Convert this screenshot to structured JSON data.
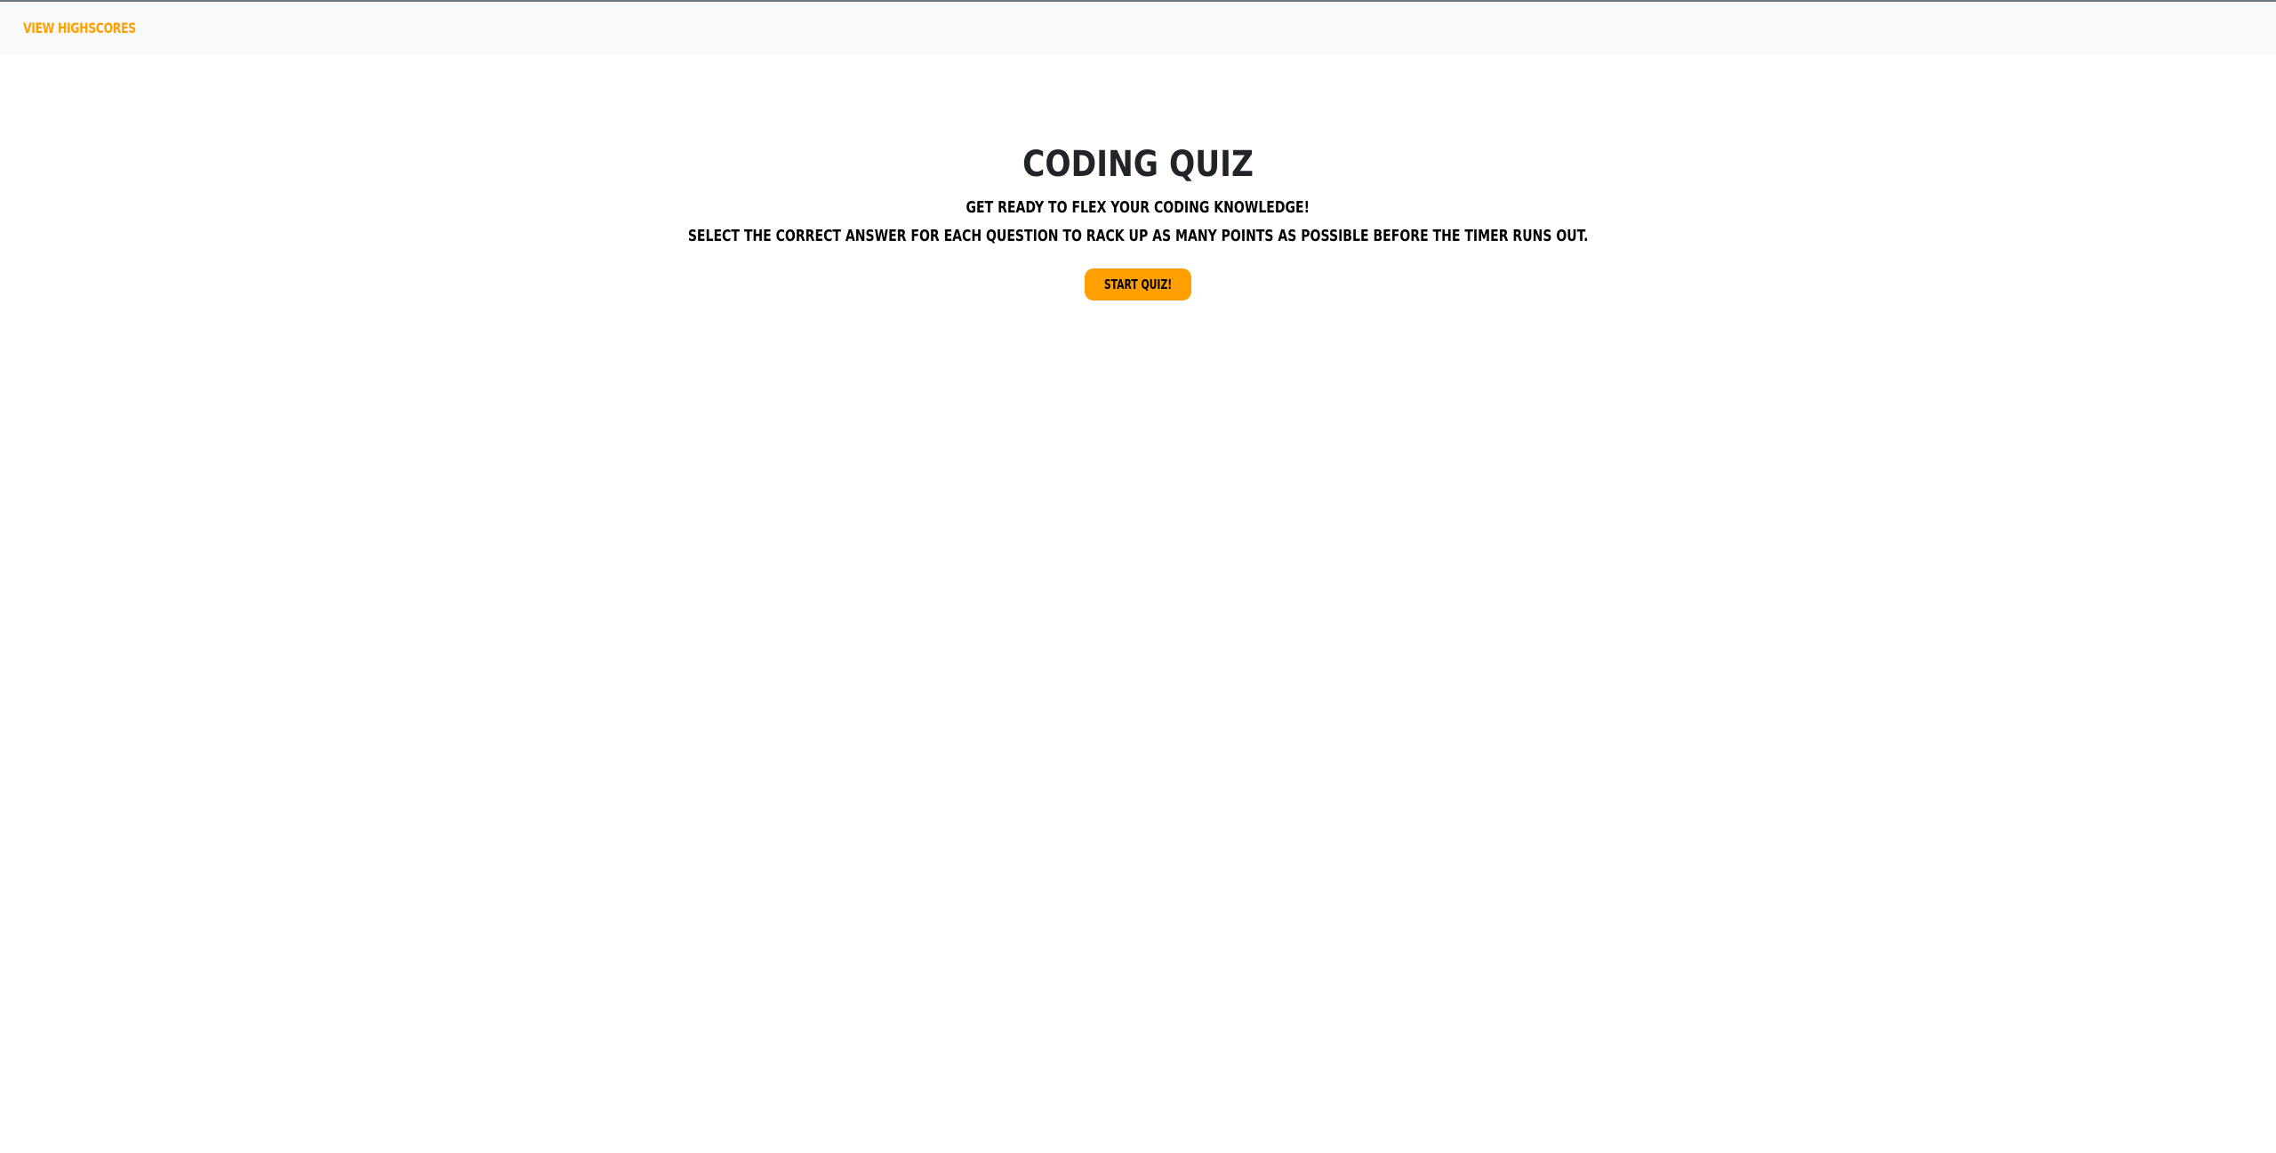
{
  "nav": {
    "highscores_link": "View Highscores"
  },
  "main": {
    "title": "Coding Quiz",
    "subtitle_line1": "Get ready to flex your coding knowledge!",
    "subtitle_line2": "Select the correct answer for each question to rack up as many points as possible before the timer runs out.",
    "start_button": "Start Quiz!"
  },
  "colors": {
    "accent": "#ff9f00",
    "navbar_bg": "#f8f9fa",
    "text": "#212529"
  }
}
